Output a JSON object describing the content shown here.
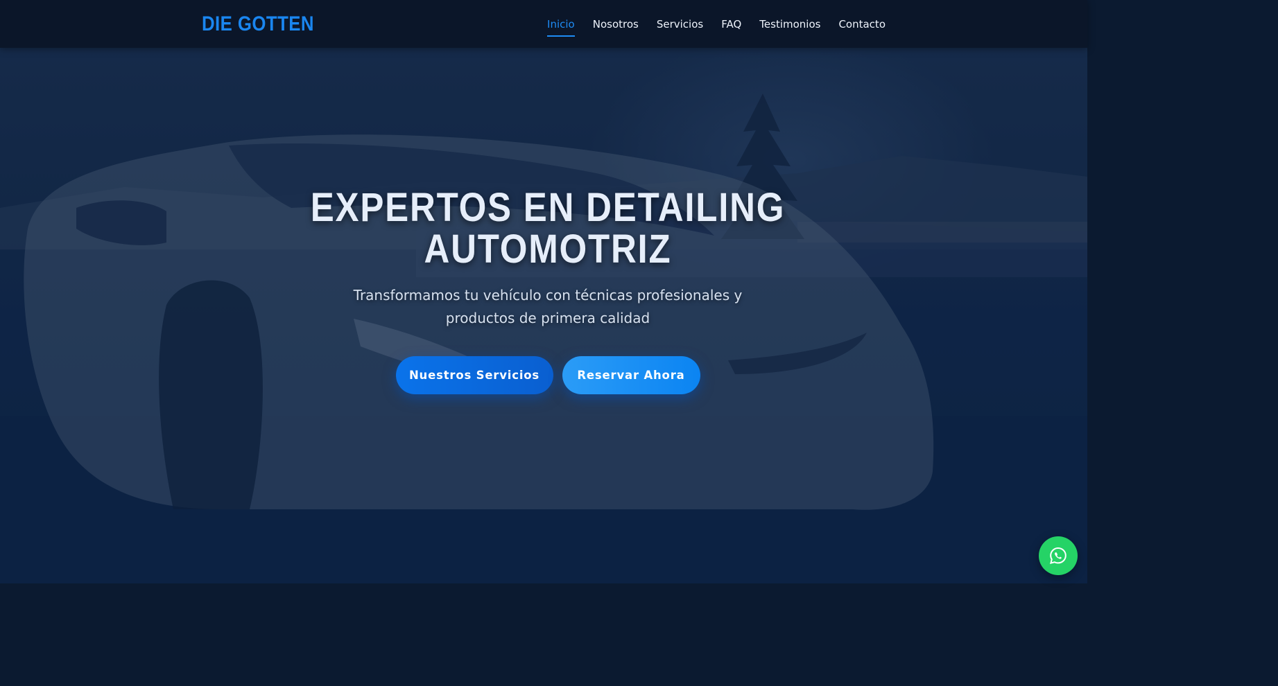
{
  "brand": {
    "logo_text": "DIE GOTTEN",
    "accent_color": "#1a86f0"
  },
  "nav": {
    "items": [
      {
        "label": "Inicio",
        "active": true
      },
      {
        "label": "Nosotros",
        "active": false
      },
      {
        "label": "Servicios",
        "active": false
      },
      {
        "label": "FAQ",
        "active": false
      },
      {
        "label": "Testimonios",
        "active": false
      },
      {
        "label": "Contacto",
        "active": false
      }
    ]
  },
  "hero": {
    "title_line1": "EXPERTOS EN DETAILING",
    "title_line2": "AUTOMOTRIZ",
    "subtitle": "Transformamos tu vehículo con técnicas profesionales y productos de primera calidad",
    "primary_button": "Nuestros Servicios",
    "secondary_button": "Reservar Ahora",
    "background_image": "sports-car-night"
  },
  "floating": {
    "whatsapp_icon": "whatsapp-icon",
    "whatsapp_color": "#25d366"
  }
}
